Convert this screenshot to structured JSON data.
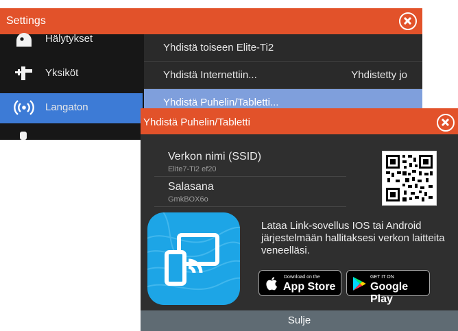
{
  "settings": {
    "title": "Settings",
    "sidebar": [
      {
        "label": "Hälytykset",
        "icon": "siren-icon"
      },
      {
        "label": "Yksiköt",
        "icon": "units-icon"
      },
      {
        "label": "Langaton",
        "icon": "wireless-icon",
        "active": true
      }
    ],
    "rows": [
      {
        "label": "Yhdistä toiseen Elite-Ti2",
        "value": ""
      },
      {
        "label": "Yhdistä Internettiin...",
        "value": "Yhdistetty jo"
      },
      {
        "label": "Yhdistä Puhelin/Tabletti...",
        "value": "",
        "selected": true
      }
    ]
  },
  "dialog": {
    "title": "Yhdistä Puhelin/Tabletti",
    "ssid_label": "Verkon nimi (SSID)",
    "ssid_value": "Elite7-Ti2 ef20",
    "password_label": "Salasana",
    "password_value": "GmkBOX6o",
    "description": "Lataa Link-sovellus IOS tai Android järjestelmään hallitaksesi verkon laitteita veneelläsi.",
    "appstore_small": "Download on the",
    "appstore_big": "App Store",
    "googleplay_small": "GET IT ON",
    "googleplay_big": "Google Play",
    "close_label": "Sulje"
  },
  "colors": {
    "accent": "#e2522a",
    "selected": "#3d7bd6",
    "app_icon": "#1da5e6"
  }
}
